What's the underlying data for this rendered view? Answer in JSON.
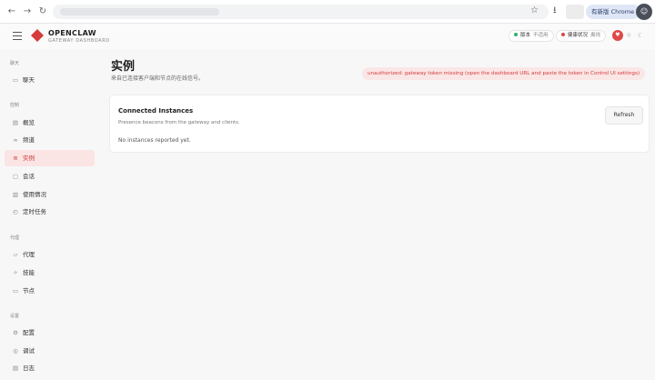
{
  "browser": {
    "back_icon": "←",
    "forward_icon": "→",
    "reload_icon": "↻",
    "star_icon": "☆",
    "download_icon": "⭳",
    "chrome_pill": "有新版 Chrome 可",
    "avatar_icon": "☺"
  },
  "header": {
    "brand_name": "OPENCLAW",
    "brand_sub": "GATEWAY DASHBOARD",
    "version_label": "版本",
    "version_value": "不适用",
    "health_label": "健康状况",
    "health_value": "离线",
    "colors": {
      "accent": "#d63a3a",
      "version_dot": "#2fb36b",
      "health_dot": "#e04848"
    }
  },
  "sidebar": {
    "sections": [
      {
        "label": "聊天",
        "items": [
          {
            "label": "聊天",
            "icon": "chat-icon",
            "glyph": "▭"
          }
        ]
      },
      {
        "label": "控制",
        "items": [
          {
            "label": "概览",
            "icon": "overview-icon",
            "glyph": "▤"
          },
          {
            "label": "频道",
            "icon": "link-icon",
            "glyph": "∞"
          },
          {
            "label": "实例",
            "icon": "instances-icon",
            "glyph": "≋"
          },
          {
            "label": "会话",
            "icon": "sessions-icon",
            "glyph": "▢"
          },
          {
            "label": "使用情况",
            "icon": "usage-icon",
            "glyph": "▥"
          },
          {
            "label": "定时任务",
            "icon": "cron-icon",
            "glyph": "◴"
          }
        ]
      },
      {
        "label": "代理",
        "items": [
          {
            "label": "代理",
            "icon": "folder-icon",
            "glyph": "▱"
          },
          {
            "label": "技能",
            "icon": "skills-icon",
            "glyph": "✧"
          },
          {
            "label": "节点",
            "icon": "nodes-icon",
            "glyph": "▭"
          }
        ]
      },
      {
        "label": "设置",
        "items": [
          {
            "label": "配置",
            "icon": "gear-icon",
            "glyph": "⚙"
          },
          {
            "label": "调试",
            "icon": "debug-icon",
            "glyph": "◎"
          },
          {
            "label": "日志",
            "icon": "logs-icon",
            "glyph": "▤"
          }
        ]
      }
    ],
    "active": "实例"
  },
  "main": {
    "title": "实例",
    "subtitle": "来自已连接客户端和节点的在线信号。",
    "error": "unauthorized: gateway token missing (open the dashboard URL and paste the token in Control UI settings)",
    "card": {
      "title": "Connected Instances",
      "description": "Presence beacons from the gateway and clients.",
      "empty": "No instances reported yet.",
      "refresh_label": "Refresh"
    }
  }
}
